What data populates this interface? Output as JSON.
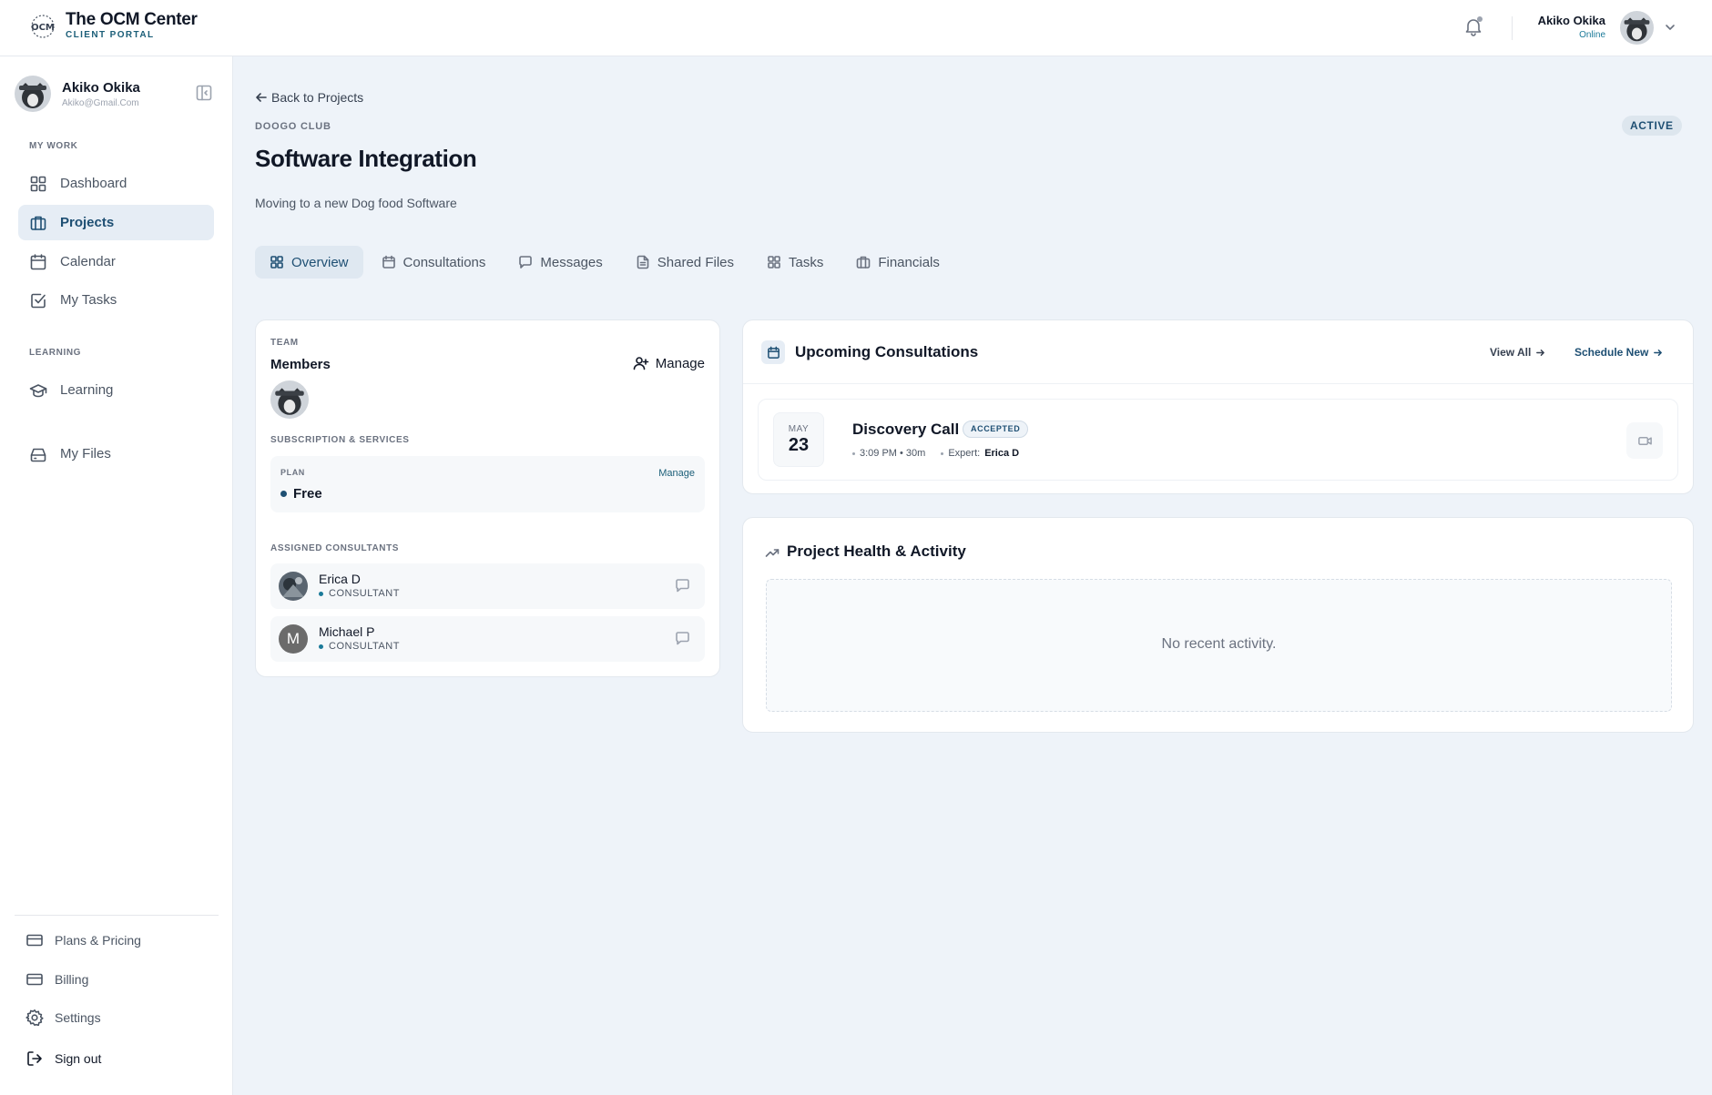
{
  "brand": {
    "name": "The OCM Center",
    "subtitle": "CLIENT PORTAL"
  },
  "topbar": {
    "user_name": "Akiko Okika",
    "user_status": "Online"
  },
  "sidebar": {
    "user": {
      "name": "Akiko Okika",
      "email": "Akiko@Gmail.Com"
    },
    "sections": {
      "my_work": "MY WORK",
      "learning": "LEARNING"
    },
    "items": [
      {
        "label": "Dashboard",
        "icon": "grid-icon"
      },
      {
        "label": "Projects",
        "icon": "briefcase-icon"
      },
      {
        "label": "Calendar",
        "icon": "calendar-icon"
      },
      {
        "label": "My Tasks",
        "icon": "checkbox-icon"
      },
      {
        "label": "Learning",
        "icon": "graduation-cap-icon"
      },
      {
        "label": "My Files",
        "icon": "drive-icon"
      }
    ],
    "bottom": [
      {
        "label": "Plans & Pricing",
        "icon": "credit-card-icon"
      },
      {
        "label": "Billing",
        "icon": "credit-card-icon"
      },
      {
        "label": "Settings",
        "icon": "gear-icon"
      },
      {
        "label": "Sign out",
        "icon": "sign-out-icon"
      }
    ]
  },
  "project": {
    "back_label": "Back to Projects",
    "org": "DOOGO CLUB",
    "title": "Software Integration",
    "description": "Moving to a new Dog food Software",
    "status": "ACTIVE"
  },
  "tabs": [
    {
      "label": "Overview",
      "active": true
    },
    {
      "label": "Consultations"
    },
    {
      "label": "Messages"
    },
    {
      "label": "Shared Files"
    },
    {
      "label": "Tasks"
    },
    {
      "label": "Financials"
    }
  ],
  "team": {
    "caption": "TEAM",
    "members_title": "Members",
    "manage_label": "Manage",
    "subscription_caption": "SUBSCRIPTION & SERVICES",
    "plan_caption": "PLAN",
    "plan_manage": "Manage",
    "plan_value": "Free",
    "consultants_caption": "ASSIGNED CONSULTANTS",
    "consultants": [
      {
        "name": "Erica D",
        "role": "CONSULTANT"
      },
      {
        "name": "Michael P",
        "role": "CONSULTANT",
        "initial": "M"
      }
    ]
  },
  "upcoming": {
    "title": "Upcoming Consultations",
    "view_all": "View All",
    "schedule_new": "Schedule New",
    "items": [
      {
        "month": "MAY",
        "day": "23",
        "title": "Discovery Call",
        "badge": "ACCEPTED",
        "time": "3:09 PM • 30m",
        "expert_label": "Expert:",
        "expert": "Erica D"
      }
    ]
  },
  "health": {
    "title": "Project Health & Activity",
    "empty": "No recent activity."
  },
  "colors": {
    "accent": "#1e4f73",
    "teal": "#1b7a99",
    "background": "#eef3f9"
  }
}
